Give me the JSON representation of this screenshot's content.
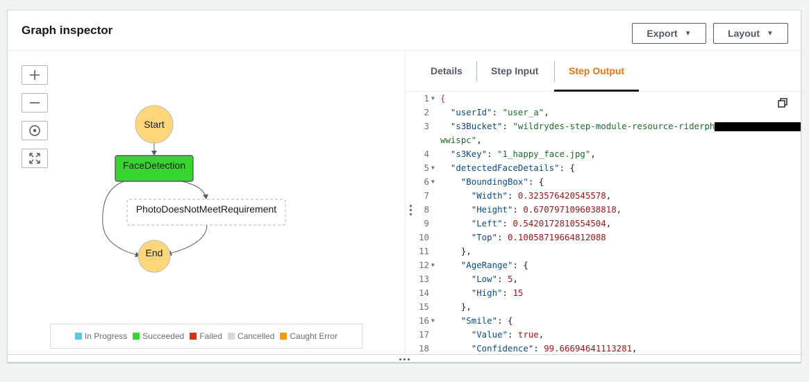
{
  "header": {
    "title": "Graph inspector",
    "export_label": "Export",
    "layout_label": "Layout"
  },
  "zoom_controls": [
    "zoom-in",
    "zoom-out",
    "center",
    "fit"
  ],
  "graph": {
    "nodes": {
      "start": "Start",
      "face_detection": "FaceDetection",
      "photo_not_meet": "PhotoDoesNotMeetRequirement",
      "end": "End"
    },
    "colors": {
      "start_end": "#ffd77a",
      "succeeded": "#38d430",
      "edge": "#545b64"
    }
  },
  "legend": [
    {
      "label": "In Progress",
      "color": "#5ec6e6"
    },
    {
      "label": "Succeeded",
      "color": "#38d430"
    },
    {
      "label": "Failed",
      "color": "#d13212"
    },
    {
      "label": "Cancelled",
      "color": "#d5dbdb"
    },
    {
      "label": "Caught Error",
      "color": "#f89c0f"
    }
  ],
  "tabs": [
    {
      "label": "Details",
      "active": false
    },
    {
      "label": "Step Input",
      "active": false
    },
    {
      "label": "Step Output",
      "active": true
    }
  ],
  "code": {
    "l1": "{",
    "l2_key": "\"userId\"",
    "l2_val": "\"user_a\"",
    "l3_key": "\"s3Bucket\"",
    "l3_val": "\"wildrydes-step-module-resource-riderph",
    "l3b_val": "wwispc\"",
    "l4_key": "\"s3Key\"",
    "l4_val": "\"1_happy_face.jpg\"",
    "l5_key": "\"detectedFaceDetails\"",
    "l6_key": "\"BoundingBox\"",
    "l7_key": "\"Width\"",
    "l7_val": "0.323576420545578",
    "l8_key": "\"Height\"",
    "l8_val": "0.6707971096038818",
    "l9_key": "\"Left\"",
    "l9_val": "0.5420172810554504",
    "l10_key": "\"Top\"",
    "l10_val": "0.10058719664812088",
    "l11": "},",
    "l12_key": "\"AgeRange\"",
    "l13_key": "\"Low\"",
    "l13_val": "5",
    "l14_key": "\"High\"",
    "l14_val": "15",
    "l15": "},",
    "l16_key": "\"Smile\"",
    "l17_key": "\"Value\"",
    "l17_val": "true",
    "l18_key": "\"Confidence\"",
    "l18_val": "99.66694641113281"
  }
}
